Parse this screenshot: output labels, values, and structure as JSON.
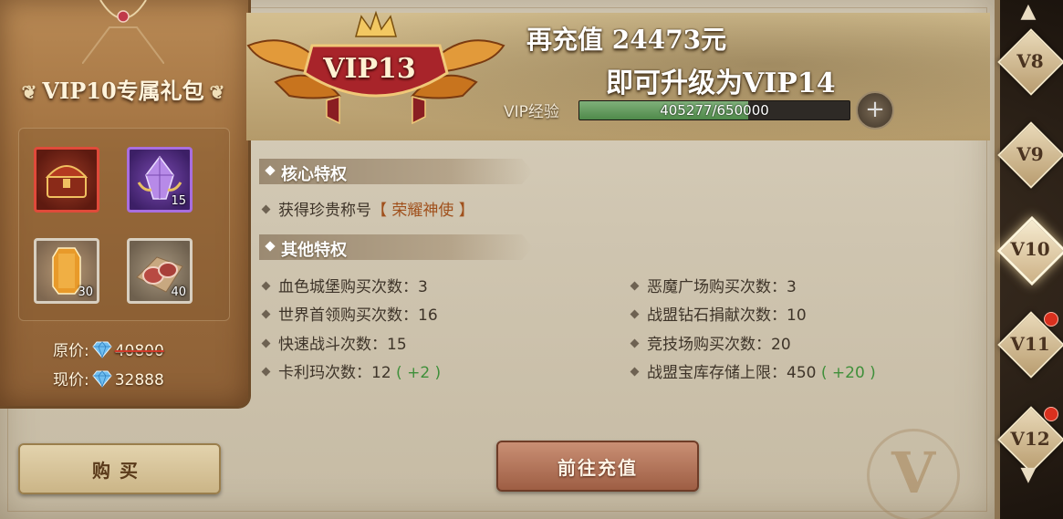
{
  "package": {
    "title": "VIP10专属礼包",
    "ornament": "❦",
    "items": [
      {
        "name": "treasure-chest",
        "count": ""
      },
      {
        "name": "purple-crystal",
        "count": "15"
      },
      {
        "name": "amber-gem",
        "count": "30"
      },
      {
        "name": "meat",
        "count": "40"
      }
    ],
    "original_price_label": "原价:",
    "original_price": "40800",
    "current_price_label": "现价:",
    "current_price": "32888",
    "buy_label": "购买"
  },
  "banner": {
    "vip_level": "VIP13",
    "recharge_text": "再充值 24473元",
    "upgrade_text": "即可升级为VIP14",
    "exp_label": "VIP经验",
    "exp_text": "405277/650000",
    "exp_fraction": 0.6235,
    "plus_symbol": "+"
  },
  "core": {
    "heading": "核心特权",
    "line_prefix": "获得珍贵称号",
    "line_title": "【 荣耀神使 】"
  },
  "other": {
    "heading": "其他特权",
    "left": [
      {
        "text": "血色城堡购买次数：3",
        "bonus": ""
      },
      {
        "text": "世界首领购买次数：16",
        "bonus": ""
      },
      {
        "text": "快速战斗次数：15",
        "bonus": ""
      },
      {
        "text": "卡利玛次数：12",
        "bonus": "( +2 )"
      }
    ],
    "right": [
      {
        "text": "恶魔广场购买次数：3",
        "bonus": ""
      },
      {
        "text": "战盟钻石捐献次数：10",
        "bonus": ""
      },
      {
        "text": "竞技场购买次数：20",
        "bonus": ""
      },
      {
        "text": "战盟宝库存储上限：450",
        "bonus": "( +20 )"
      }
    ]
  },
  "charge_button": "前往充值",
  "watermark": "V",
  "nav": {
    "up_arrow": "▲",
    "down_arrow": "▼",
    "tiers": [
      {
        "label": "V8",
        "badge": false,
        "active": false
      },
      {
        "label": "V9",
        "badge": false,
        "active": false
      },
      {
        "label": "V10",
        "badge": false,
        "active": true
      },
      {
        "label": "V11",
        "badge": true,
        "active": false
      },
      {
        "label": "V12",
        "badge": true,
        "active": false
      }
    ]
  },
  "colors": {
    "highlight": "#a0501c",
    "bonus": "#3f8f3a",
    "badge": "#d9301e",
    "exp_fill": "#4f8a4a"
  }
}
